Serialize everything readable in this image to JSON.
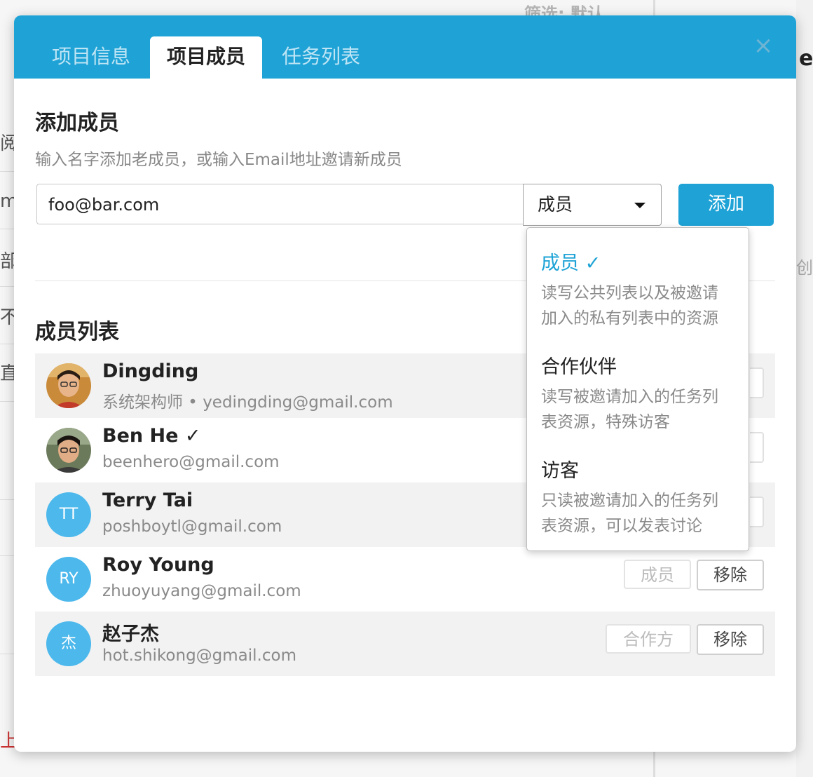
{
  "background": {
    "filter_text": "筛选: 默认",
    "edge_fragments": [
      "阅",
      "m",
      "部",
      "不",
      "直",
      "上"
    ],
    "right_fragment": "e",
    "far_right_fragment": "创"
  },
  "modal": {
    "tabs": [
      {
        "label": "项目信息",
        "active": false
      },
      {
        "label": "项目成员",
        "active": true
      },
      {
        "label": "任务列表",
        "active": false
      }
    ],
    "close_glyph": "×",
    "add_section": {
      "title": "添加成员",
      "hint": "输入名字添加老成员，或输入Email地址邀请新成员",
      "input_value": "foo@bar.com",
      "role_selected": "成员",
      "add_label": "添加"
    },
    "list_title": "成员列表",
    "members": [
      {
        "name": "Dingding",
        "subtitle": "系统架构师 • yedingding@gmail.com",
        "avatar": "photo",
        "initials": ""
      },
      {
        "name": "Ben He ✓",
        "subtitle": "beenhero@gmail.com",
        "avatar": "photo",
        "initials": ""
      },
      {
        "name": "Terry Tai",
        "subtitle": "poshboytl@gmail.com",
        "avatar": "initials",
        "initials": "TT"
      },
      {
        "name": "Roy Young",
        "subtitle": "zhuoyuyang@gmail.com",
        "avatar": "initials",
        "initials": "RY",
        "role": "成员",
        "remove": "移除"
      },
      {
        "name": "赵子杰",
        "subtitle": "hot.shikong@gmail.com",
        "avatar": "initials",
        "initials": "杰",
        "role": "合作方",
        "remove": "移除"
      }
    ],
    "role_menu": [
      {
        "label": "成员 ✓",
        "desc_lines": [
          "读写公共列表以及被邀请",
          "加入的私有列表中的资源"
        ],
        "selected": true
      },
      {
        "label": "合作伙伴",
        "desc_lines": [
          "读写被邀请加入的任务列",
          "表资源，特殊访客"
        ],
        "selected": false
      },
      {
        "label": "访客",
        "desc_lines": [
          "只读被邀请加入的任务列",
          "表资源，可以发表讨论"
        ],
        "selected": false
      }
    ]
  },
  "colors": {
    "accent": "#1fa3d6",
    "avatar_blue": "#4cb8ec"
  }
}
